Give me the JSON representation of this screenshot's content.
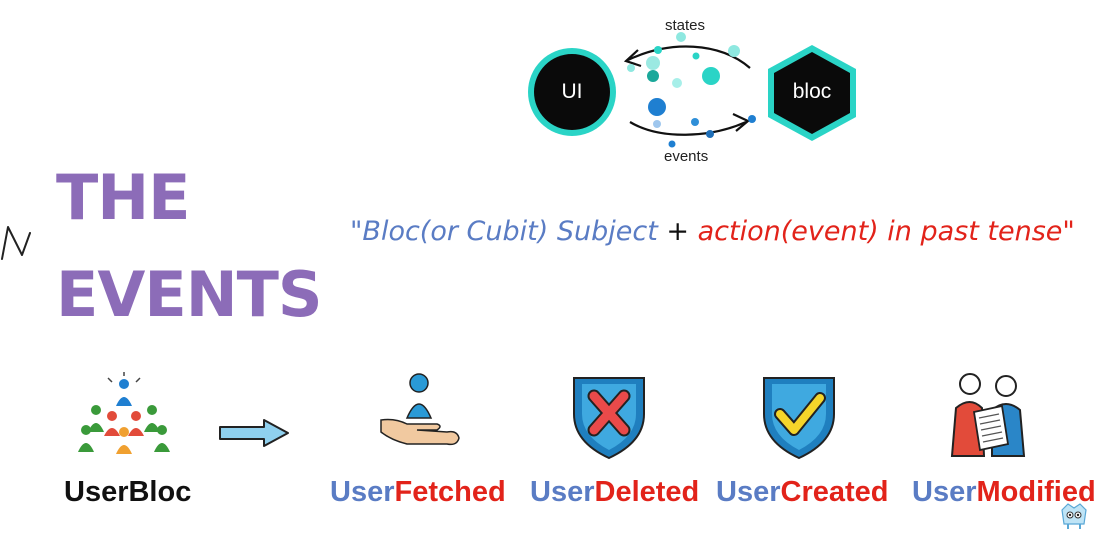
{
  "diagram": {
    "ui_label": "UI",
    "bloc_label": "bloc",
    "states_label": "states",
    "events_label": "events"
  },
  "heading": {
    "line1": "THE",
    "line2": "EVENTS"
  },
  "formula": {
    "open_quote": "\"",
    "subject": "Bloc(or Cubit) Subject",
    "plus": "+",
    "action": "action(event) in past tense",
    "close_quote": "\""
  },
  "source": {
    "name": "UserBloc",
    "icon": "group-of-people-icon"
  },
  "events": [
    {
      "prefix": "User",
      "suffix": "Fetched",
      "icon": "person-in-hand-icon"
    },
    {
      "prefix": "User",
      "suffix": "Deleted",
      "icon": "shield-x-icon"
    },
    {
      "prefix": "User",
      "suffix": "Created",
      "icon": "shield-check-icon"
    },
    {
      "prefix": "User",
      "suffix": "Modified",
      "icon": "people-with-document-icon"
    }
  ],
  "colors": {
    "heading": "#8c6cb8",
    "subject_blue": "#5a7cc4",
    "action_red": "#e2231a",
    "teal": "#2ad4c6"
  }
}
